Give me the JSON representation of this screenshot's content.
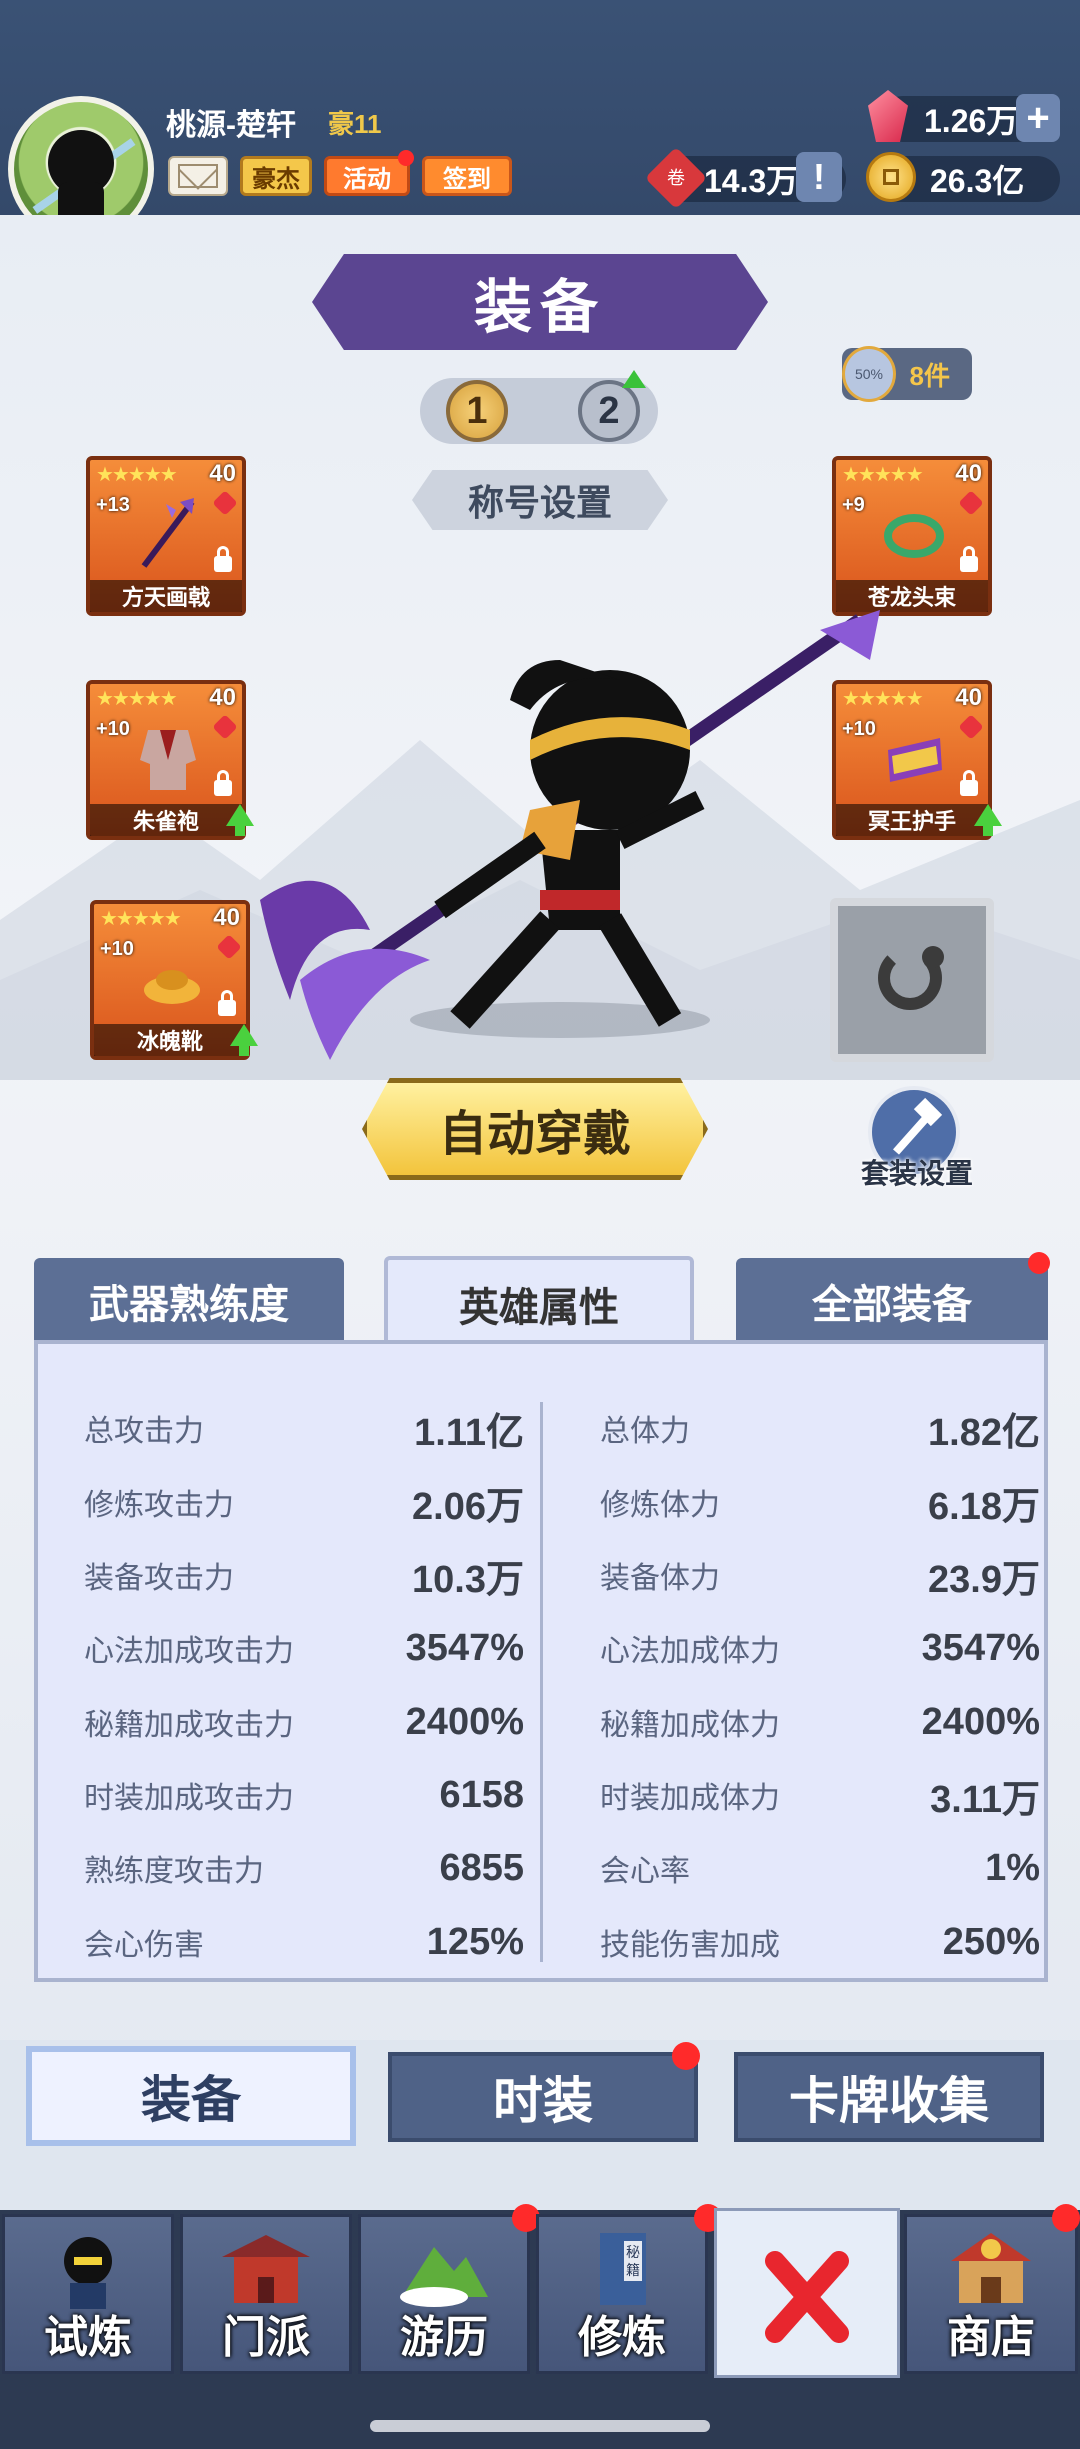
{
  "header": {
    "player_name": "桃源-楚轩",
    "vip": "豪11",
    "buttons": {
      "hero": "豪杰",
      "event": "活动",
      "signin": "签到"
    },
    "gems": "1.26万",
    "gem_plus": "+",
    "ticket_icon": "卷",
    "tickets": "14.3万",
    "info": "!",
    "coins": "26.3亿"
  },
  "equipment": {
    "title": "装备",
    "pages": [
      "1",
      "2"
    ],
    "title_setting": "称号设置",
    "set_count": "8件",
    "set_badge": "50%",
    "slots": [
      {
        "name": "方天画戟",
        "level": "40",
        "plus": "+13",
        "stars": "★★★★★",
        "upgrade": false
      },
      {
        "name": "朱雀袍",
        "level": "40",
        "plus": "+10",
        "stars": "★★★★★",
        "upgrade": true
      },
      {
        "name": "冰魄靴",
        "level": "40",
        "plus": "+10",
        "stars": "★★★★★",
        "upgrade": true
      },
      {
        "name": "苍龙头束",
        "level": "40",
        "plus": "+9",
        "stars": "★★★★★",
        "upgrade": false
      },
      {
        "name": "冥王护手",
        "level": "40",
        "plus": "+10",
        "stars": "★★★★★",
        "upgrade": true
      }
    ],
    "auto_wear": "自动穿戴",
    "suit_setting": "套装设置"
  },
  "tabs": {
    "weapon": "武器熟练度",
    "hero": "英雄属性",
    "all": "全部装备"
  },
  "stats": {
    "left": [
      {
        "label": "总攻击力",
        "value": "1.11亿"
      },
      {
        "label": "修炼攻击力",
        "value": "2.06万"
      },
      {
        "label": "装备攻击力",
        "value": "10.3万"
      },
      {
        "label": "心法加成攻击力",
        "value": "3547%"
      },
      {
        "label": "秘籍加成攻击力",
        "value": "2400%"
      },
      {
        "label": "时装加成攻击力",
        "value": "6158"
      },
      {
        "label": "熟练度攻击力",
        "value": "6855"
      },
      {
        "label": "会心伤害",
        "value": "125%"
      }
    ],
    "right": [
      {
        "label": "总体力",
        "value": "1.82亿"
      },
      {
        "label": "修炼体力",
        "value": "6.18万"
      },
      {
        "label": "装备体力",
        "value": "23.9万"
      },
      {
        "label": "心法加成体力",
        "value": "3547%"
      },
      {
        "label": "秘籍加成体力",
        "value": "2400%"
      },
      {
        "label": "时装加成体力",
        "value": "3.11万"
      },
      {
        "label": "会心率",
        "value": "1%"
      },
      {
        "label": "技能伤害加成",
        "value": "250%"
      }
    ]
  },
  "subtabs": {
    "equip": "装备",
    "fashion": "时装",
    "cards": "卡牌收集"
  },
  "nav": {
    "trial": "试炼",
    "sect": "门派",
    "travel": "游历",
    "cultivate": "修炼",
    "book_label": "秘籍",
    "shop": "商店"
  },
  "colors": {
    "accent_purple": "#5b4591",
    "orange_card": "#f58d3a",
    "red_dot": "#ff2a2a",
    "nav_bg": "#46567a"
  }
}
